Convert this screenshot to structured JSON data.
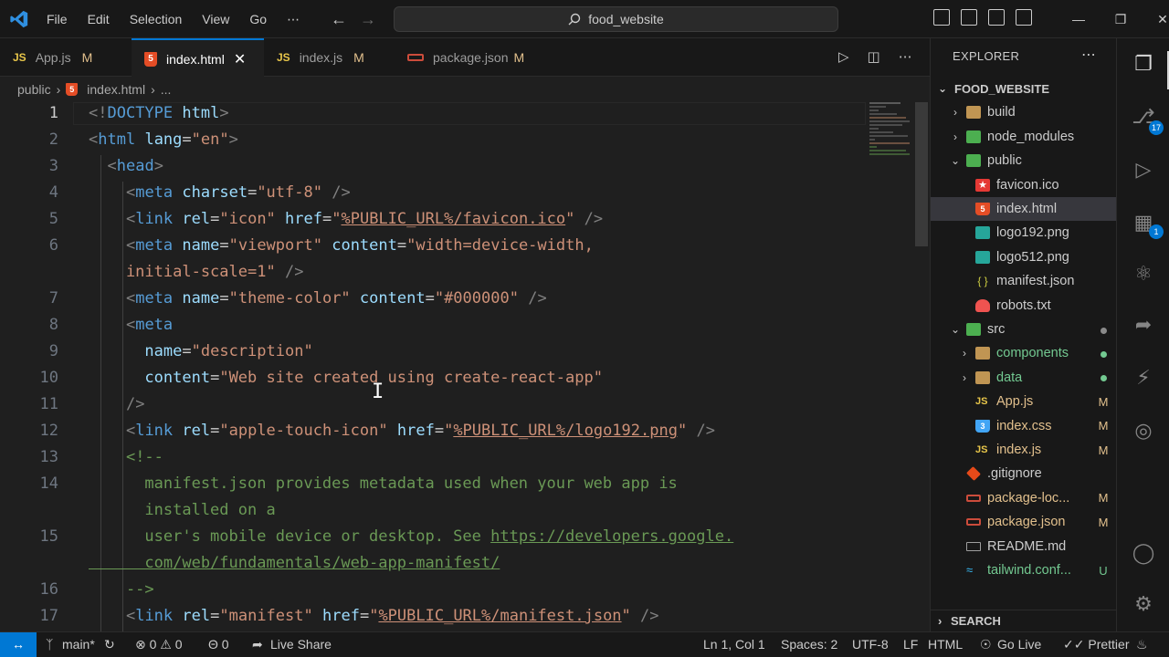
{
  "titlebar": {
    "menu": [
      "File",
      "Edit",
      "Selection",
      "View",
      "Go",
      "⋯"
    ],
    "search_text": "food_website",
    "window_controls": [
      "—",
      "❐",
      "✕"
    ]
  },
  "tabs": [
    {
      "icon": "JS",
      "label": "App.js",
      "status": "M"
    },
    {
      "icon": "html",
      "label": "index.html",
      "close": "✕"
    },
    {
      "icon": "JS",
      "label": "index.js",
      "status": "M"
    },
    {
      "icon": "json",
      "label": "package.json",
      "status": "M"
    }
  ],
  "breadcrumb": {
    "folder": "public",
    "file": "index.html",
    "more": "..."
  },
  "editor": {
    "line_numbers": [
      "1",
      "2",
      "3",
      "4",
      "5",
      "6",
      "",
      "7",
      "8",
      "9",
      "10",
      "11",
      "12",
      "13",
      "14",
      "",
      "15",
      "",
      "16",
      "17"
    ],
    "lines": [
      [
        [
          "t",
          "<!"
        ],
        [
          "n",
          "DOCTYPE"
        ],
        [
          "p",
          " "
        ],
        [
          "a",
          "html"
        ],
        [
          "t",
          ">"
        ]
      ],
      [
        [
          "t",
          "<"
        ],
        [
          "n",
          "html"
        ],
        [
          "p",
          " "
        ],
        [
          "a",
          "lang"
        ],
        [
          "p",
          "="
        ],
        [
          "s",
          "\"en\""
        ],
        [
          "t",
          ">"
        ]
      ],
      [
        [
          "p",
          "  "
        ],
        [
          "t",
          "<"
        ],
        [
          "n",
          "head"
        ],
        [
          "t",
          ">"
        ]
      ],
      [
        [
          "p",
          "    "
        ],
        [
          "t",
          "<"
        ],
        [
          "n",
          "meta"
        ],
        [
          "p",
          " "
        ],
        [
          "a",
          "charset"
        ],
        [
          "p",
          "="
        ],
        [
          "s",
          "\"utf-8\""
        ],
        [
          "p",
          " "
        ],
        [
          "t",
          "/>"
        ]
      ],
      [
        [
          "p",
          "    "
        ],
        [
          "t",
          "<"
        ],
        [
          "n",
          "link"
        ],
        [
          "p",
          " "
        ],
        [
          "a",
          "rel"
        ],
        [
          "p",
          "="
        ],
        [
          "s",
          "\"icon\""
        ],
        [
          "p",
          " "
        ],
        [
          "a",
          "href"
        ],
        [
          "p",
          "="
        ],
        [
          "s",
          "\""
        ],
        [
          "su",
          "%PUBLIC_URL%/favicon.ico"
        ],
        [
          "s",
          "\""
        ],
        [
          "p",
          " "
        ],
        [
          "t",
          "/>"
        ]
      ],
      [
        [
          "p",
          "    "
        ],
        [
          "t",
          "<"
        ],
        [
          "n",
          "meta"
        ],
        [
          "p",
          " "
        ],
        [
          "a",
          "name"
        ],
        [
          "p",
          "="
        ],
        [
          "s",
          "\"viewport\""
        ],
        [
          "p",
          " "
        ],
        [
          "a",
          "content"
        ],
        [
          "p",
          "="
        ],
        [
          "s",
          "\"width=device-width,"
        ]
      ],
      [
        [
          "s",
          "    initial-scale=1\""
        ],
        [
          "p",
          " "
        ],
        [
          "t",
          "/>"
        ]
      ],
      [
        [
          "p",
          "    "
        ],
        [
          "t",
          "<"
        ],
        [
          "n",
          "meta"
        ],
        [
          "p",
          " "
        ],
        [
          "a",
          "name"
        ],
        [
          "p",
          "="
        ],
        [
          "s",
          "\"theme-color\""
        ],
        [
          "p",
          " "
        ],
        [
          "a",
          "content"
        ],
        [
          "p",
          "="
        ],
        [
          "s",
          "\"#000000\""
        ],
        [
          "p",
          " "
        ],
        [
          "t",
          "/>"
        ]
      ],
      [
        [
          "p",
          "    "
        ],
        [
          "t",
          "<"
        ],
        [
          "n",
          "meta"
        ]
      ],
      [
        [
          "p",
          "      "
        ],
        [
          "a",
          "name"
        ],
        [
          "p",
          "="
        ],
        [
          "s",
          "\"description\""
        ]
      ],
      [
        [
          "p",
          "      "
        ],
        [
          "a",
          "content"
        ],
        [
          "p",
          "="
        ],
        [
          "s",
          "\"Web site created using create-react-app\""
        ]
      ],
      [
        [
          "p",
          "    "
        ],
        [
          "t",
          "/>"
        ]
      ],
      [
        [
          "p",
          "    "
        ],
        [
          "t",
          "<"
        ],
        [
          "n",
          "link"
        ],
        [
          "p",
          " "
        ],
        [
          "a",
          "rel"
        ],
        [
          "p",
          "="
        ],
        [
          "s",
          "\"apple-touch-icon\""
        ],
        [
          "p",
          " "
        ],
        [
          "a",
          "href"
        ],
        [
          "p",
          "="
        ],
        [
          "s",
          "\""
        ],
        [
          "su",
          "%PUBLIC_URL%/logo192.png"
        ],
        [
          "s",
          "\""
        ],
        [
          "p",
          " "
        ],
        [
          "t",
          "/>"
        ]
      ],
      [
        [
          "p",
          "    "
        ],
        [
          "c",
          "<!--"
        ]
      ],
      [
        [
          "c",
          "      manifest.json provides metadata used when your web app is"
        ]
      ],
      [
        [
          "c",
          "      installed on a"
        ]
      ],
      [
        [
          "c",
          "      user's mobile device or desktop. See "
        ],
        [
          "cu",
          "https://developers.google."
        ]
      ],
      [
        [
          "cu",
          "      com/web/fundamentals/web-app-manifest/"
        ]
      ],
      [
        [
          "c",
          "    -->"
        ]
      ],
      [
        [
          "p",
          "    "
        ],
        [
          "t",
          "<"
        ],
        [
          "n",
          "link"
        ],
        [
          "p",
          " "
        ],
        [
          "a",
          "rel"
        ],
        [
          "p",
          "="
        ],
        [
          "s",
          "\"manifest\""
        ],
        [
          "p",
          " "
        ],
        [
          "a",
          "href"
        ],
        [
          "p",
          "="
        ],
        [
          "s",
          "\""
        ],
        [
          "su",
          "%PUBLIC_URL%/manifest.json"
        ],
        [
          "s",
          "\""
        ],
        [
          "p",
          " "
        ],
        [
          "t",
          "/>"
        ]
      ]
    ]
  },
  "explorer": {
    "title": "EXPLORER",
    "more": "⋯",
    "root": "FOOD_WEBSITE",
    "items": [
      {
        "label": "build",
        "chev": "›",
        "indent": 1,
        "icon": "folder"
      },
      {
        "label": "node_modules",
        "chev": "›",
        "indent": 1,
        "icon": "folder-green"
      },
      {
        "label": "public",
        "chev": "⌄",
        "indent": 1,
        "icon": "folder-green"
      },
      {
        "label": "favicon.ico",
        "indent": 2,
        "icon": "star"
      },
      {
        "label": "index.html",
        "indent": 2,
        "icon": "html",
        "selected": true
      },
      {
        "label": "logo192.png",
        "indent": 2,
        "icon": "image"
      },
      {
        "label": "logo512.png",
        "indent": 2,
        "icon": "image"
      },
      {
        "label": "manifest.json",
        "indent": 2,
        "icon": "braces"
      },
      {
        "label": "robots.txt",
        "indent": 2,
        "icon": "robot"
      },
      {
        "label": "src",
        "chev": "⌄",
        "indent": 1,
        "icon": "folder-green",
        "dot": "#8a8a8a"
      },
      {
        "label": "components",
        "chev": "›",
        "indent": 2,
        "icon": "folder",
        "dot": "#73c991",
        "color": "#73c991"
      },
      {
        "label": "data",
        "chev": "›",
        "indent": 2,
        "icon": "folder",
        "dot": "#73c991",
        "color": "#73c991"
      },
      {
        "label": "App.js",
        "indent": 2,
        "icon": "js",
        "status": "M",
        "color": "#e2c08d"
      },
      {
        "label": "index.css",
        "indent": 2,
        "icon": "css",
        "status": "M",
        "color": "#e2c08d"
      },
      {
        "label": "index.js",
        "indent": 2,
        "icon": "js",
        "status": "M",
        "color": "#e2c08d"
      },
      {
        "label": ".gitignore",
        "indent": 1,
        "icon": "git"
      },
      {
        "label": "package-loc...",
        "indent": 1,
        "icon": "json",
        "status": "M",
        "color": "#e2c08d"
      },
      {
        "label": "package.json",
        "indent": 1,
        "icon": "json",
        "status": "M",
        "color": "#e2c08d"
      },
      {
        "label": "README.md",
        "indent": 1,
        "icon": "readme"
      },
      {
        "label": "tailwind.conf...",
        "indent": 1,
        "icon": "tailwind",
        "status": "U",
        "color": "#73c991"
      }
    ],
    "search_section": "SEARCH"
  },
  "activity_badges": {
    "source_control": "17",
    "extensions": "1"
  },
  "statusbar": {
    "remote": "↔",
    "branch": "main*",
    "sync": "↻",
    "problems": "⊗ 0 ⚠ 0",
    "ports": "Θ 0",
    "live_share": "Live Share",
    "position": "Ln 1, Col 1",
    "spaces": "Spaces: 2",
    "encoding": "UTF-8",
    "eol": "LF",
    "language": "HTML",
    "go_live": "Go Live",
    "prettier": "✓✓ Prettier",
    "bell": "🔔"
  },
  "colors": {
    "accent": "#0078d4",
    "tag": "#569cd6",
    "attribute": "#9cdcfe",
    "string": "#ce9178",
    "comment": "#6a9955",
    "modified": "#e2c08d",
    "untracked": "#73c991"
  }
}
